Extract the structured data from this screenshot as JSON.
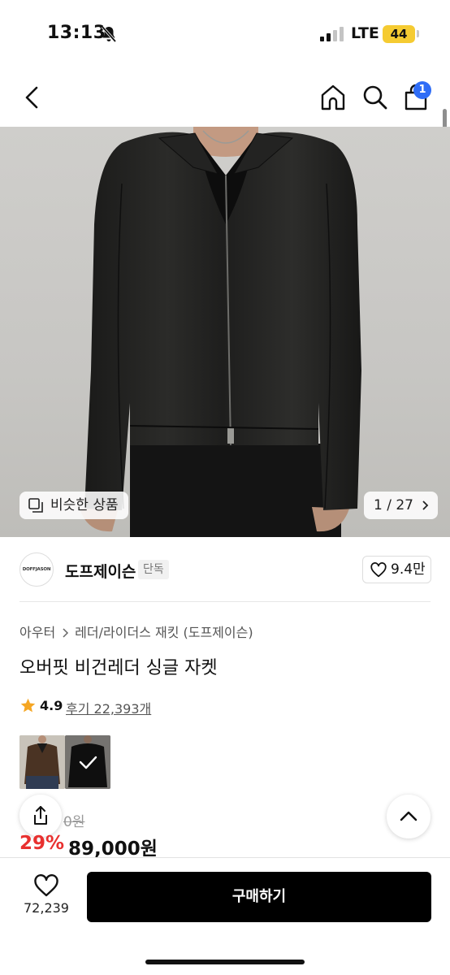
{
  "status_bar": {
    "time": "13:13",
    "network": "LTE",
    "battery": "44"
  },
  "nav": {
    "cart_count": "1"
  },
  "gallery": {
    "similar_label": "비슷한 상품",
    "counter": "1 / 27"
  },
  "brand": {
    "logo_text": "DOFFJASON",
    "name": "도프제이슨",
    "tag": "단독",
    "likes": "9.4만"
  },
  "breadcrumb": {
    "category": "아우터",
    "subcategory": "레더/라이더스 재킷 (도프제이슨)"
  },
  "product": {
    "title": "오버핏 비건레더 싱글 자켓",
    "rating": "4.9",
    "reviews": "후기 22,393개",
    "original_price": "0원",
    "discount": "29%",
    "price": "89,000원"
  },
  "bottom": {
    "wish_count": "72,239",
    "buy_label": "구매하기"
  },
  "colors": {
    "accent_blue": "#2f6df6",
    "discount_red": "#e8302f",
    "battery_yellow": "#f5cb32",
    "star_orange": "#f5a623"
  }
}
